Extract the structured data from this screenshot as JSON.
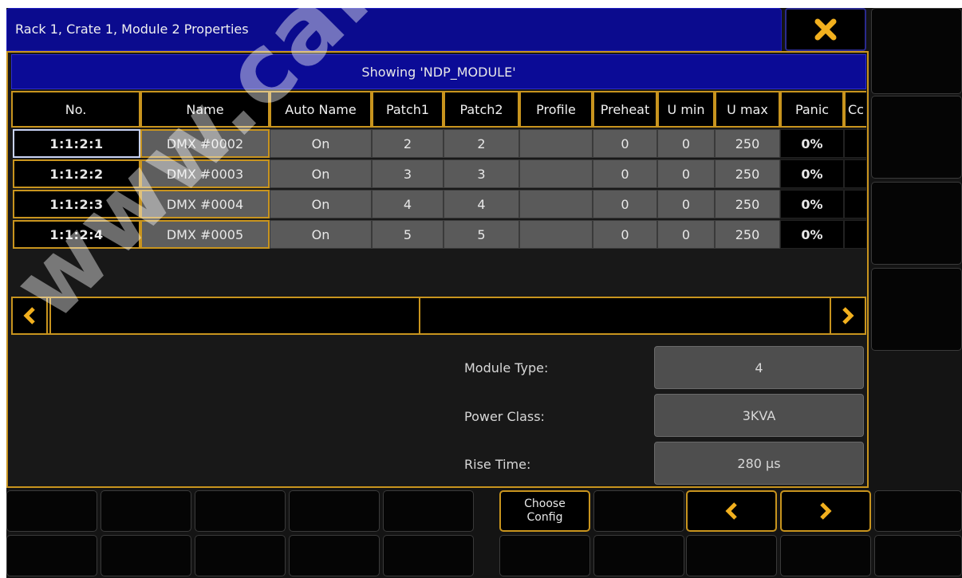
{
  "window": {
    "title": "Rack 1, Crate 1, Module 2 Properties"
  },
  "showing": "Showing 'NDP_MODULE'",
  "table": {
    "columns": [
      "No.",
      "Name",
      "Auto Name",
      "Patch1",
      "Patch2",
      "Profile",
      "Preheat",
      "U min",
      "U max",
      "Panic",
      "Cc"
    ],
    "rows": [
      {
        "no": "1:1:2:1",
        "name": "DMX #0002",
        "auto_name": "On",
        "patch1": "2",
        "patch2": "2",
        "profile": "",
        "preheat": "0",
        "umin": "0",
        "umax": "250",
        "panic": "0%"
      },
      {
        "no": "1:1:2:2",
        "name": "DMX #0003",
        "auto_name": "On",
        "patch1": "3",
        "patch2": "3",
        "profile": "",
        "preheat": "0",
        "umin": "0",
        "umax": "250",
        "panic": "0%"
      },
      {
        "no": "1:1:2:3",
        "name": "DMX #0004",
        "auto_name": "On",
        "patch1": "4",
        "patch2": "4",
        "profile": "",
        "preheat": "0",
        "umin": "0",
        "umax": "250",
        "panic": "0%"
      },
      {
        "no": "1:1:2:4",
        "name": "DMX #0005",
        "auto_name": "On",
        "patch1": "5",
        "patch2": "5",
        "profile": "",
        "preheat": "0",
        "umin": "0",
        "umax": "250",
        "panic": "0%"
      }
    ]
  },
  "properties": {
    "module_type": {
      "label": "Module Type:",
      "value": "4"
    },
    "power_class": {
      "label": "Power Class:",
      "value": "3KVA"
    },
    "rise_time": {
      "label": "Rise Time:",
      "value": "280 µs"
    }
  },
  "bottom": {
    "choose_config": "Choose\nConfig"
  },
  "watermark": "www.carlosmen",
  "colors": {
    "accent": "#c8941e",
    "title_blue": "#0b0b8e",
    "cell_gray": "#5a5a5a"
  },
  "icons": {
    "close": "close-icon",
    "left": "chevron-left-icon",
    "right": "chevron-right-icon"
  }
}
